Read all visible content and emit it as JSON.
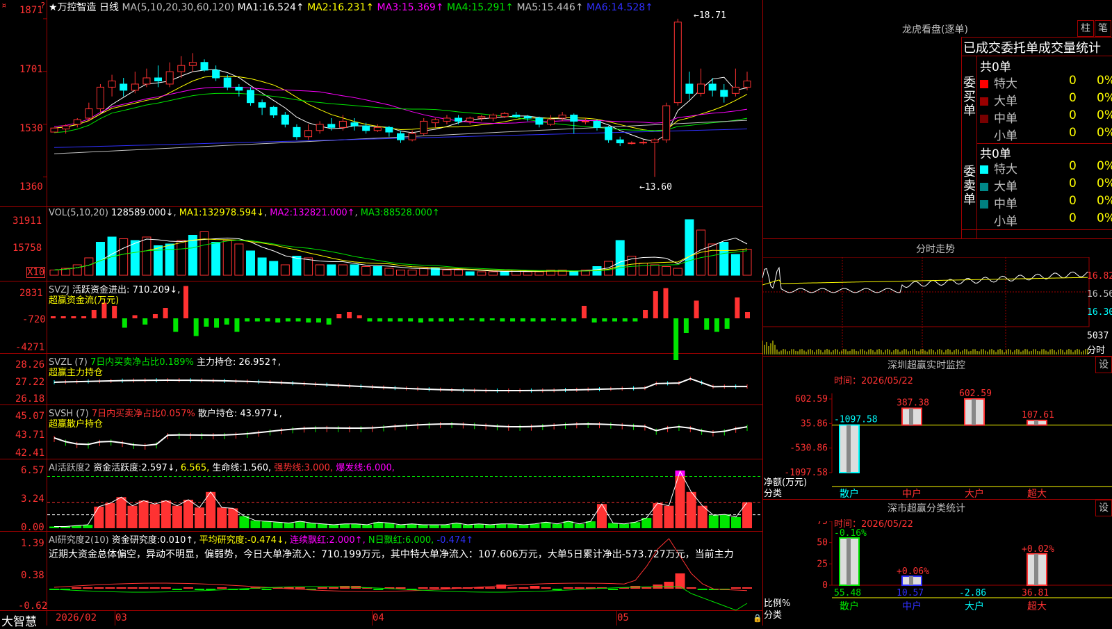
{
  "chart_data": [
    {
      "type": "candlestick",
      "title": "★万控智造 日线",
      "indicator": "MA(5,10,20,30,60,120)",
      "ma_values": [
        {
          "name": "MA1",
          "value": "16.524↑",
          "color": "#ffffff"
        },
        {
          "name": "MA2",
          "value": "16.231↑",
          "color": "#ffff00"
        },
        {
          "name": "MA3",
          "value": "15.369↑",
          "color": "#ff00ff"
        },
        {
          "name": "MA4",
          "value": "15.291↑",
          "color": "#00e600"
        },
        {
          "name": "MA5",
          "value": "15.446↑",
          "color": "#c0c0c0"
        },
        {
          "name": "MA6",
          "value": "14.528↑",
          "color": "#3030ff"
        }
      ],
      "y_ticks": [
        "1871",
        "1701",
        "1530",
        "1360"
      ],
      "annotations": {
        "high": "18.71",
        "low": "13.60"
      },
      "x_ticks": [
        "2026/02",
        "03",
        "04",
        "05"
      ],
      "ylim": [
        13.3,
        19.0
      ],
      "candles": [
        [
          15.05,
          15.18,
          15.05,
          15.2
        ],
        [
          15.15,
          15.25,
          15.0,
          15.3
        ],
        [
          15.3,
          15.45,
          15.2,
          15.5
        ],
        [
          15.5,
          15.8,
          15.4,
          16.0
        ],
        [
          15.8,
          16.5,
          15.7,
          16.6
        ],
        [
          16.5,
          16.7,
          16.2,
          16.9
        ],
        [
          16.6,
          16.4,
          16.2,
          16.8
        ],
        [
          16.4,
          16.6,
          16.3,
          17.0
        ],
        [
          16.6,
          16.8,
          16.5,
          17.1
        ],
        [
          16.8,
          16.7,
          16.5,
          17.2
        ],
        [
          16.6,
          17.0,
          16.5,
          17.3
        ],
        [
          17.0,
          17.2,
          16.8,
          17.5
        ],
        [
          17.2,
          17.3,
          17.0,
          17.6
        ],
        [
          17.3,
          17.05,
          17.0,
          17.4
        ],
        [
          17.05,
          16.8,
          16.7,
          17.2
        ],
        [
          16.8,
          16.5,
          16.4,
          16.9
        ],
        [
          16.5,
          16.4,
          16.2,
          16.6
        ],
        [
          16.4,
          16.0,
          15.9,
          16.5
        ],
        [
          16.0,
          15.85,
          15.6,
          16.1
        ],
        [
          15.85,
          15.6,
          15.5,
          15.9
        ],
        [
          15.6,
          15.3,
          15.2,
          15.7
        ],
        [
          15.2,
          14.9,
          14.8,
          15.3
        ],
        [
          14.9,
          15.1,
          14.8,
          15.3
        ],
        [
          15.1,
          15.3,
          15.0,
          15.4
        ],
        [
          15.3,
          15.2,
          15.1,
          15.5
        ],
        [
          15.2,
          15.4,
          15.1,
          15.6
        ],
        [
          15.35,
          15.25,
          15.1,
          15.5
        ],
        [
          15.25,
          15.1,
          15.0,
          15.35
        ],
        [
          15.1,
          15.2,
          15.05,
          15.3
        ],
        [
          15.2,
          15.05,
          14.9,
          15.25
        ],
        [
          15.0,
          14.8,
          14.7,
          15.1
        ],
        [
          14.8,
          15.0,
          14.75,
          15.1
        ],
        [
          15.0,
          15.4,
          14.95,
          15.5
        ],
        [
          15.35,
          15.45,
          15.2,
          15.5
        ],
        [
          15.4,
          15.5,
          15.3,
          15.6
        ],
        [
          15.5,
          15.4,
          15.3,
          15.6
        ],
        [
          15.4,
          15.5,
          15.3,
          15.55
        ],
        [
          15.5,
          15.55,
          15.4,
          15.6
        ],
        [
          15.5,
          15.6,
          15.4,
          15.65
        ],
        [
          15.55,
          15.65,
          15.5,
          15.7
        ],
        [
          15.6,
          15.55,
          15.5,
          15.7
        ],
        [
          15.55,
          15.5,
          15.4,
          15.6
        ],
        [
          15.5,
          15.3,
          15.2,
          15.55
        ],
        [
          15.3,
          15.45,
          15.25,
          15.6
        ],
        [
          15.5,
          15.6,
          15.4,
          15.7
        ],
        [
          15.6,
          15.4,
          15.0,
          15.65
        ],
        [
          15.4,
          15.4,
          15.3,
          15.5
        ],
        [
          15.4,
          15.2,
          15.1,
          15.45
        ],
        [
          15.2,
          14.8,
          14.7,
          15.25
        ],
        [
          14.8,
          14.7,
          14.6,
          14.9
        ],
        [
          14.7,
          14.7,
          14.65,
          14.75
        ],
        [
          14.7,
          14.72,
          14.65,
          14.8
        ],
        [
          14.72,
          14.8,
          13.6,
          14.85
        ],
        [
          14.8,
          15.9,
          14.7,
          16.0
        ],
        [
          16.0,
          18.6,
          15.9,
          18.71
        ],
        [
          16.6,
          16.3,
          16.1,
          17.0
        ],
        [
          16.3,
          16.6,
          16.2,
          17.1
        ],
        [
          16.6,
          16.4,
          16.2,
          16.8
        ],
        [
          16.4,
          16.2,
          16.0,
          16.6
        ],
        [
          16.3,
          16.5,
          16.2,
          17.1
        ],
        [
          16.5,
          16.7,
          16.4,
          17.0
        ]
      ],
      "colors": {
        "up": "#ff3232",
        "down": "#00ffff",
        "axis": "#a00000"
      }
    },
    {
      "type": "bar",
      "title": "VOL(5,10,20)",
      "vol_values": [
        {
          "name": "",
          "value": "128589.000↓",
          "color": "#ffffff"
        },
        {
          "name": "MA1",
          "value": "132978.594↓",
          "color": "#ffff00"
        },
        {
          "name": "MA2",
          "value": "132821.000↑",
          "color": "#ff00ff"
        },
        {
          "name": "MA3",
          "value": "88528.000↑",
          "color": "#00e600"
        }
      ],
      "y_ticks": [
        "31911",
        "15758",
        "X10"
      ],
      "values": [
        3,
        4,
        6,
        10,
        19,
        22,
        21,
        20,
        22,
        17,
        18,
        20,
        23,
        25,
        19,
        20,
        18,
        14,
        10,
        8,
        6,
        11,
        10,
        6,
        6,
        6,
        6,
        5,
        5,
        4,
        3,
        3,
        4,
        4,
        3,
        3,
        2,
        2,
        2,
        2,
        3,
        2,
        2,
        3,
        3,
        2,
        3,
        5,
        8,
        20,
        11,
        7,
        6,
        5,
        4,
        32,
        26,
        18,
        19,
        12,
        15
      ]
    },
    {
      "type": "bar",
      "title": "SVZJ",
      "label1": "活跃资金进出:",
      "value1": "710.209↓,",
      "label2": "超赢资金流(万元)",
      "y_ticks": [
        "2831",
        "-720",
        "-4271"
      ],
      "values": [
        0,
        0,
        0,
        0,
        800,
        1500,
        1200,
        -900,
        300,
        -600,
        400,
        1000,
        -1300,
        3100,
        -1700,
        -800,
        -900,
        -600,
        -1300,
        -300,
        -300,
        -300,
        -400,
        -300,
        -300,
        -400,
        -400,
        -600,
        400,
        600,
        300,
        -300,
        -300,
        -300,
        -300,
        -300,
        -400,
        -300,
        -300,
        -300,
        -200,
        -200,
        -300,
        -200,
        -300,
        -300,
        -300,
        -300,
        -300,
        -200,
        -300,
        -300,
        1200,
        -400,
        -300,
        -300,
        -300,
        -300,
        800,
        2600,
        2900,
        -4000,
        -1400,
        1700,
        -1100,
        -1300,
        -1000,
        2000,
        600
      ]
    },
    {
      "type": "line",
      "title": "SVZL (7)",
      "label1": "7日内买卖净占比0.189%",
      "label2": "主力持仓:",
      "value2": "26.952↑,",
      "label3": "超赢主力持仓",
      "y_ticks": [
        "28.26",
        "27.22",
        "26.18"
      ]
    },
    {
      "type": "line",
      "title": "SVSH (7)",
      "label1": "7日内买卖净占比0.057%",
      "label2": "散户持仓:",
      "value2": "43.977↓,",
      "label3": "超赢散户持仓",
      "y_ticks": [
        "45.07",
        "43.71",
        "42.41"
      ]
    },
    {
      "type": "bar",
      "title": "AI活跃度2",
      "label1": "资金活跃度:",
      "value1": "2.597↓,",
      "value2": "6.565,",
      "label3": "生命线:",
      "value3": "1.560,",
      "label4": "强势线:",
      "value4": "3.000,",
      "label5": "爆发线:",
      "value5": "6.000,",
      "y_ticks": [
        "6.57",
        "3.24",
        "0.00"
      ],
      "values": [
        0.2,
        0.2,
        0.3,
        0.4,
        2.5,
        2.9,
        3.6,
        2.6,
        3.2,
        2.8,
        3.2,
        2.6,
        3.3,
        2.4,
        4.2,
        2.4,
        2.3,
        1.4,
        0.9,
        0.8,
        0.7,
        0.6,
        0.8,
        0.6,
        0.5,
        0.4,
        0.5,
        0.5,
        0.4,
        0.7,
        0.6,
        0.4,
        0.5,
        0.4,
        0.4,
        0.4,
        0.6,
        0.4,
        0.5,
        0.4,
        0.5,
        0.5,
        0.4,
        0.5,
        0.7,
        0.5,
        0.8,
        0.5,
        0.8,
        2.8,
        0.6,
        0.5,
        0.7,
        1.2,
        2.9,
        2.6,
        6.6,
        4.2,
        2.6,
        1.5,
        1.6,
        1.3,
        3.0
      ]
    },
    {
      "type": "bar",
      "title": "AI研究度2(10)",
      "label1": "资金研究度:",
      "value1": "0.010↑,",
      "label2": "平均研究度:",
      "value2": "-0.474↓,",
      "label3": "连续飘红:",
      "value3": "2.000↑,",
      "label4": "N日飘红:",
      "value4": "6.000,",
      "value5": "-0.474↑",
      "summary": "近期大资金总体偏空，异动不明显，偏弱势，今日大单净流入：710.199万元，其中特大单净流入：107.606万元，大单5日累计净出-573.727万元，当前主力",
      "y_ticks": [
        "1.39",
        "0.38",
        "-0.62"
      ],
      "values": [
        -0.05,
        -0.05,
        0.02,
        0.02,
        0.02,
        0.02,
        0.02,
        0.02,
        0.02,
        0.02,
        0.02,
        -0.05,
        0.02,
        -0.05,
        -0.05,
        0.02,
        -0.05,
        -0.05,
        0.02,
        -0.05,
        0.02,
        0.05,
        0.02,
        -0.05,
        0.02,
        0.05,
        0.1,
        0.1,
        0.05,
        -0.05,
        0.02,
        0.02,
        -0.05,
        0.02,
        0.02,
        0.02,
        0.02,
        0.02,
        0.02,
        0.05,
        0.15,
        0.05,
        0.05,
        0.1,
        0.02,
        -0.05,
        0.02,
        0.05,
        0.05,
        0.02,
        -0.05,
        0.02,
        0.1,
        0.05,
        0.15,
        0.25,
        0.55,
        0.02,
        -0.05,
        -0.05,
        -0.05,
        0.02,
        0.02
      ]
    },
    {
      "type": "bar",
      "title": "深圳超赢实时监控",
      "time_label": "时间：2026/05/22",
      "y_ticks": [
        "602.59",
        "35.86",
        "-530.86",
        "-1097.58"
      ],
      "ylabel": "净额(万元)",
      "xlabel": "分类",
      "categories": [
        "散户",
        "中户",
        "大户",
        "超大"
      ],
      "values": [
        -1097.58,
        387.38,
        602.59,
        107.61
      ],
      "value_labels": [
        "-1097.58",
        "387.38",
        "602.59",
        "107.61"
      ],
      "ylim": [
        -1097.58,
        602.59
      ]
    },
    {
      "type": "bar",
      "title": "深市超赢分类统计",
      "time_label": "时间：2026/05/22",
      "y_ticks": [
        "75",
        "50",
        "25",
        "0"
      ],
      "ylabel": "比例%",
      "xlabel": "分类",
      "categories": [
        "散户",
        "中户",
        "大户",
        "超大"
      ],
      "values": [
        55.48,
        10.57,
        -2.86,
        36.81
      ],
      "value_labels": [
        "55.48",
        "10.57",
        "-2.86",
        "36.81"
      ],
      "change_labels": [
        "-0.16%",
        "+0.06%",
        "",
        "+0.02%"
      ],
      "ylim": [
        0,
        75
      ]
    }
  ],
  "top": {
    "title_prefix": "★万控智造",
    "period": "日线",
    "indicator": "MA(5,10,20,30,60,120)"
  },
  "bottom": {
    "brand": "大智慧"
  },
  "right": {
    "lhkp_title": "龙虎看盘(逐单)",
    "btn_bar": "柱",
    "btn_pen": "笔",
    "tabs_title": "已成交委托单成交量统计",
    "buy_title": "委买单",
    "sell_title": "委卖单",
    "buy_total": "共0单",
    "sell_total": "共0单",
    "rows": [
      {
        "label": "特大",
        "count": "0",
        "pct": "0%"
      },
      {
        "label": "大单",
        "count": "0",
        "pct": "0%"
      },
      {
        "label": "中单",
        "count": "0",
        "pct": "0%"
      },
      {
        "label": "小单",
        "count": "0",
        "pct": "0%"
      }
    ],
    "fs_title": "分时走势",
    "fs_prices": [
      "16.82",
      "16.56",
      "16.30"
    ],
    "fs_vol": "5037",
    "fs_vol_unit": "分时",
    "set_btn": "设"
  }
}
